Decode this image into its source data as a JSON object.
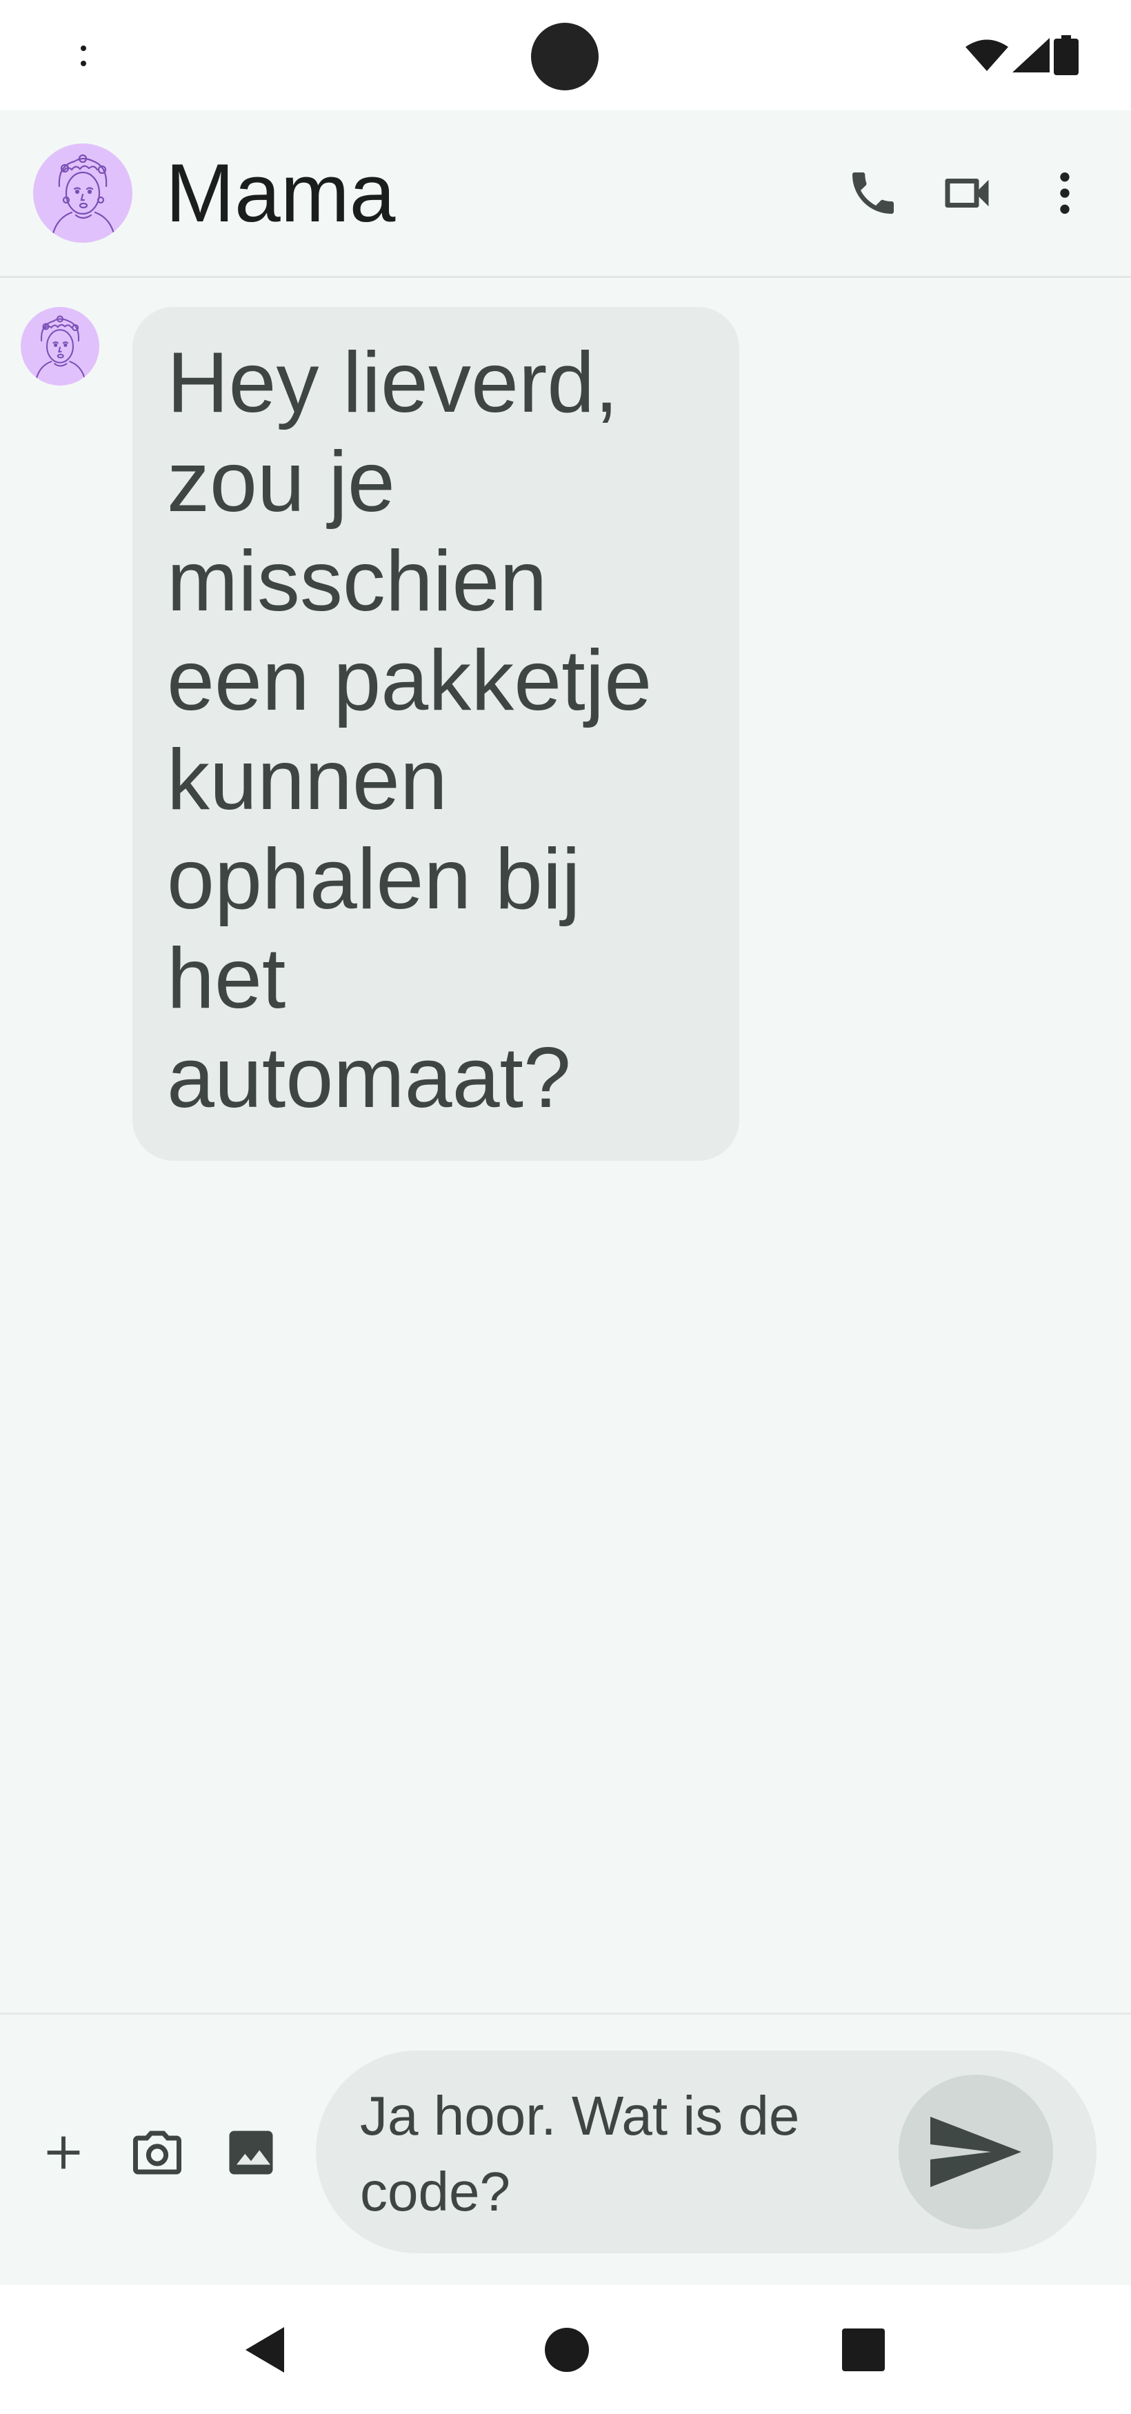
{
  "status_bar": {
    "icons": [
      "overflow-dots-icon",
      "wifi-icon",
      "signal-icon",
      "battery-icon"
    ]
  },
  "conversation": {
    "contact_name": "Mama",
    "avatar": "cartoon-woman-portrait",
    "actions": [
      "phone-icon",
      "video-call-icon",
      "more-vertical-icon"
    ]
  },
  "messages": [
    {
      "direction": "incoming",
      "text": "Hey lieverd, zou je misschien een pakketje kunnen ophalen bij het automaat?"
    }
  ],
  "compose": {
    "buttons": [
      "plus-icon",
      "camera-icon",
      "gallery-icon"
    ],
    "draft_text": "Ja hoor. Wat is de code?",
    "send_icon": "send-icon"
  },
  "navigation": {
    "buttons": [
      "back-icon",
      "home-icon",
      "recents-icon"
    ]
  },
  "colors": {
    "background": "#f3f8f6",
    "bubble": "#e7ecea",
    "avatar": "#e1c1fb",
    "text": "#3e4543",
    "send_button": "#d2d8d5"
  }
}
